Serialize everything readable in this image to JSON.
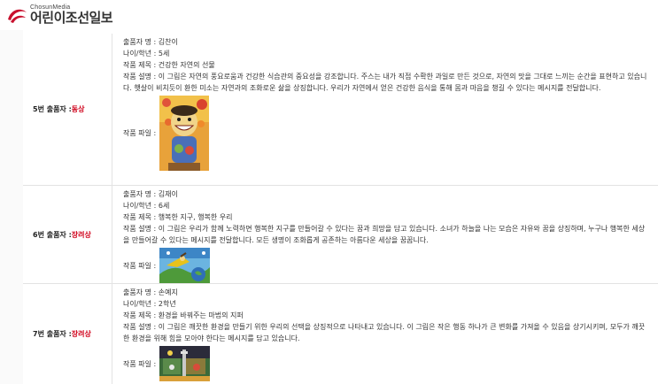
{
  "header": {
    "logo_sub": "ChosunMedia",
    "logo_main": "어린이조선일보"
  },
  "entries": [
    {
      "entry_no": "5번 출품자 : ",
      "award": "동상",
      "author": "출품자 명 : 김찬이",
      "age": "나이/학년 : 5세",
      "title": "작품 제목 : 건강한 자연의 선물",
      "description": "작품 설명 : 이 그림은 자연의 풍요로움과 건강한 식습관의 중요성을 강조합니다. 주스는 내가 직접 수확한 과일로 만든 것으로, 자연의 맛을 그대로 느끼는 순간을 표현하고 있습니다. 햇살이 비치듯이 환한 미소는 자연과의 조화로운 삶을 상징합니다. 우리가 자연에서 얻은 건강한 음식을 통해 몸과 마음을 챙길 수 있다는 메시지를 전달합니다.",
      "file_label": "작품 파일 :"
    },
    {
      "entry_no": "6번 출품자 : ",
      "award": "장려상",
      "author": "출품자 명 : 김재이",
      "age": "나이/학년 : 6세",
      "title": "작품 제목 : 행복한 지구, 행복한 우리",
      "description": "작품 설명 : 이 그림은 우리가 함께 노력하면 행복한 지구를 만들어갈 수 있다는 꿈과 희망을 담고 있습니다. 소녀가 하늘을 나는 모습은 자유와 꿈을 상징하며, 누구나 행복한 세상을 만들어갈 수 있다는 메시지를 전달합니다. 모든 생명이 조화롭게 공존하는 아름다운 세상을 꿈꿉니다.",
      "file_label": "작품 파일 :"
    },
    {
      "entry_no": "7번 출품자 : ",
      "award": "장려상",
      "author": "출품자 명 : 손예지",
      "age": "나이/학년 : 2학년",
      "title": "작품 제목 : 환경을 바꿔주는 마법의 지퍼",
      "description": "작품 설명 : 이 그림은 깨끗한 환경을 만들기 위한 우리의 선택을 상징적으로 나타내고 있습니다. 이 그림은 작은 행동 하나가 큰 변화를 가져올 수 있음을 상기시키며, 모두가 깨끗한 환경을 위해 힘을 모아야 한다는 메시지를 담고 있습니다.",
      "file_label": "작품 파일 :"
    }
  ],
  "colors": {
    "award": "#d0021b",
    "logo_red": "#c8102e"
  }
}
